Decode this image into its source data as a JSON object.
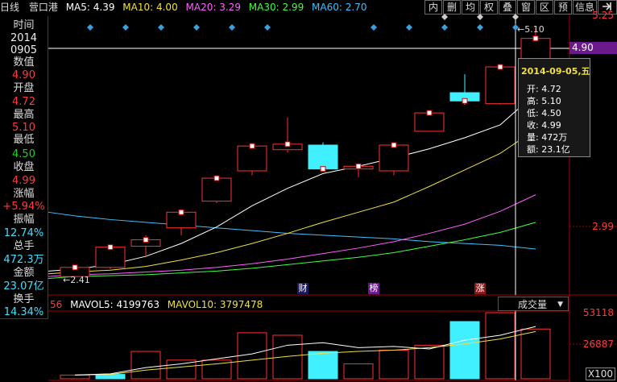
{
  "topbar": {
    "period": "日线",
    "stock_name": "营口港",
    "ma5": "MA5: 4.39",
    "ma10": "MA10: 4.00",
    "ma20": "MA20: 3.29",
    "ma30": "MA30: 2.99",
    "ma60": "MA60: 2.70",
    "buttons": [
      "内",
      "删",
      "均",
      "权",
      "叠",
      "窗",
      "区",
      "预",
      "信息"
    ],
    "arrow_icon": "arrow-right-icon",
    "colors": {
      "ma5": "#ffffff",
      "ma10": "#f0e040",
      "ma20": "#ff60ff",
      "ma30": "#40ff40",
      "ma60": "#40c0ff"
    }
  },
  "panel": {
    "time_label": "时间",
    "date_year": "2014",
    "date_md": "0905",
    "value_label": "数值",
    "value": "4.90",
    "open_label": "开盘",
    "open": "4.72",
    "high_label": "最高",
    "high": "5.10",
    "low_label": "最低",
    "low": "4.50",
    "close_label": "收盘",
    "close": "4.99",
    "change_label": "涨幅",
    "change": "+5.94%",
    "amplitude_label": "振幅",
    "amplitude": "12.74%",
    "volume_label": "总手",
    "volume": "472.3万",
    "amount_label": "金额",
    "amount": "23.07亿",
    "turnover_label": "换手",
    "turnover": "14.34%"
  },
  "tooltip": {
    "date": "2014-09-05,五",
    "open": "开: 4.72",
    "high": "高: 5.10",
    "low": "低: 4.50",
    "close": "收: 4.99",
    "volume": "量: 472万",
    "amount": "额: 23.1亿"
  },
  "price_axis": {
    "top": "5.25",
    "current": "4.90",
    "mid": "2.99"
  },
  "high_marker": "5.10",
  "low_marker": "2.41",
  "events": [
    "财",
    "榜",
    "涨"
  ],
  "volume_panel": {
    "left_fragment": "56",
    "mavol5": "MAVOL5: 4199763",
    "mavol10": "MAVOL10: 3797478",
    "indicator": "成交量",
    "axis_top": "53118",
    "axis_mid": "26887",
    "axis_unit": "X100"
  },
  "chart_data": {
    "type": "candlestick",
    "candles": [
      {
        "open": 2.4,
        "close": 2.5,
        "high": 2.52,
        "low": 2.38
      },
      {
        "open": 2.5,
        "close": 2.72,
        "high": 2.75,
        "low": 2.48
      },
      {
        "open": 2.73,
        "close": 2.8,
        "high": 2.85,
        "low": 2.62
      },
      {
        "open": 2.93,
        "close": 3.1,
        "high": 3.13,
        "low": 2.85
      },
      {
        "open": 3.22,
        "close": 3.47,
        "high": 3.5,
        "low": 3.2
      },
      {
        "open": 3.55,
        "close": 3.82,
        "high": 3.85,
        "low": 3.5
      },
      {
        "open": 3.78,
        "close": 3.84,
        "high": 4.13,
        "low": 3.75
      },
      {
        "open": 3.83,
        "close": 3.57,
        "high": 3.86,
        "low": 3.54
      },
      {
        "open": 3.57,
        "close": 3.6,
        "high": 3.62,
        "low": 3.48
      },
      {
        "open": 3.55,
        "close": 3.83,
        "high": 3.86,
        "low": 3.5
      },
      {
        "open": 3.98,
        "close": 4.18,
        "high": 4.19,
        "low": 3.98
      },
      {
        "open": 4.4,
        "close": 4.31,
        "high": 4.6,
        "low": 4.27
      },
      {
        "open": 4.28,
        "close": 4.68,
        "high": 4.7,
        "low": 4.27
      },
      {
        "open": 4.72,
        "close": 4.99,
        "high": 5.1,
        "low": 4.5
      }
    ],
    "ma5": [
      2.48,
      2.53,
      2.62,
      2.76,
      2.94,
      3.17,
      3.36,
      3.52,
      3.6,
      3.69,
      3.79,
      3.91,
      4.05,
      4.39
    ],
    "ma10": [
      2.45,
      2.47,
      2.51,
      2.58,
      2.66,
      2.76,
      2.87,
      2.99,
      3.1,
      3.21,
      3.38,
      3.56,
      3.74,
      4.0
    ],
    "ma20": [
      2.42,
      2.43,
      2.45,
      2.47,
      2.5,
      2.54,
      2.59,
      2.65,
      2.71,
      2.78,
      2.87,
      2.97,
      3.11,
      3.29
    ],
    "ma30": [
      2.4,
      2.41,
      2.42,
      2.44,
      2.46,
      2.49,
      2.53,
      2.57,
      2.61,
      2.66,
      2.73,
      2.8,
      2.88,
      2.99
    ],
    "ma60": [
      3.06,
      3.02,
      2.99,
      2.96,
      2.93,
      2.9,
      2.87,
      2.85,
      2.83,
      2.81,
      2.78,
      2.76,
      2.74,
      2.7
    ],
    "volumes": [
      3000,
      3500,
      22000,
      15000,
      15000,
      37000,
      35000,
      22000,
      12000,
      23000,
      27000,
      46000,
      53118,
      40000
    ],
    "vol_up": [
      true,
      false,
      true,
      true,
      true,
      true,
      true,
      false,
      true,
      true,
      true,
      false,
      true,
      true
    ],
    "mavol5": [
      3000,
      4000,
      9000,
      12000,
      16000,
      20000,
      27000,
      29000,
      25000,
      26000,
      24000,
      31000,
      35000,
      42000
    ],
    "mavol10": [
      3000,
      3500,
      7000,
      9500,
      12000,
      15000,
      18000,
      20500,
      22000,
      23000,
      25000,
      28000,
      32000,
      38000
    ],
    "ylim": [
      2.2,
      5.25
    ],
    "vol_ylim": [
      0,
      53118
    ],
    "grid": false
  }
}
